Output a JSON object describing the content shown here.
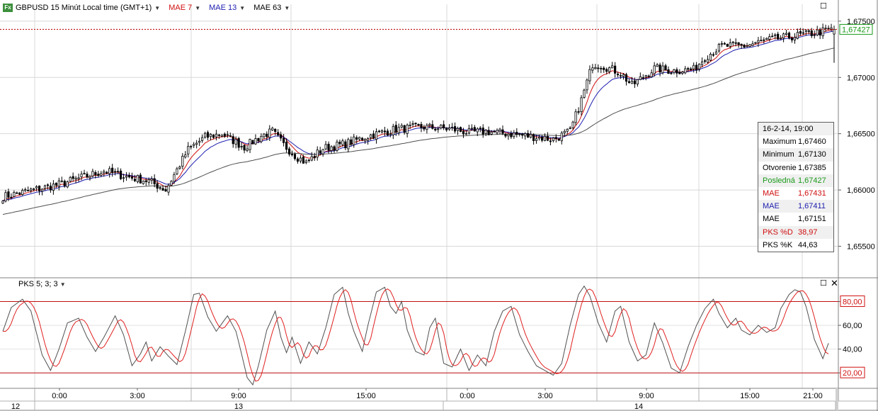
{
  "header": {
    "fx_label": "Fx",
    "title": "GBPUSD 15 Minút Local time (GMT+1)",
    "ma": [
      {
        "label": "MAE 7",
        "color": "#d01010"
      },
      {
        "label": "MAE 13",
        "color": "#2020b0"
      },
      {
        "label": "MAE 63",
        "color": "#000000"
      }
    ]
  },
  "info_box": {
    "date": "16-2-14, 19:00",
    "rows": [
      {
        "label": "Maximum",
        "value": "1,67460",
        "color": "#000000"
      },
      {
        "label": "Minimum",
        "value": "1,67130",
        "color": "#000000"
      },
      {
        "label": "Otvorenie",
        "value": "1,67385",
        "color": "#000000"
      },
      {
        "label": "Posledná",
        "value": "1,67427",
        "color": "#1a9a1a"
      },
      {
        "label": "MAE",
        "value": "1,67431",
        "color": "#d01010"
      },
      {
        "label": "MAE",
        "value": "1,67411",
        "color": "#2020b0"
      },
      {
        "label": "MAE",
        "value": "1,67151",
        "color": "#000000"
      },
      {
        "label": "PKS %D",
        "value": "38,97",
        "color": "#d01010"
      },
      {
        "label": "PKS %K",
        "value": "44,63",
        "color": "#000000"
      }
    ]
  },
  "indicator": {
    "label": "PKS 5; 3; 3"
  },
  "chart_data": [
    {
      "type": "candlestick",
      "title": "GBPUSD 15 Minút Local time (GMT+1)",
      "y_ticks": [
        "1,67500",
        "1,67000",
        "1,66500",
        "1,66000",
        "1,65500"
      ],
      "y_tick_values": [
        1.675,
        1.67,
        1.665,
        1.66,
        1.655
      ],
      "ylim": [
        1.6522,
        1.6765
      ],
      "last_price": "1,67427",
      "last_price_value": 1.67427,
      "grid": true,
      "price_anchors": [
        [
          0,
          1.6594
        ],
        [
          20,
          1.6605
        ],
        [
          36,
          1.6617
        ],
        [
          44,
          1.6612
        ],
        [
          52,
          1.6608
        ],
        [
          58,
          1.66
        ],
        [
          66,
          1.6636
        ],
        [
          72,
          1.6647
        ],
        [
          78,
          1.665
        ],
        [
          86,
          1.6638
        ],
        [
          92,
          1.6648
        ],
        [
          96,
          1.6652
        ],
        [
          100,
          1.664
        ],
        [
          104,
          1.6631
        ],
        [
          108,
          1.6624
        ],
        [
          114,
          1.6637
        ],
        [
          122,
          1.6641
        ],
        [
          130,
          1.6648
        ],
        [
          140,
          1.6654
        ],
        [
          150,
          1.6656
        ],
        [
          160,
          1.6654
        ],
        [
          166,
          1.6651
        ],
        [
          172,
          1.6652
        ],
        [
          180,
          1.665
        ],
        [
          190,
          1.6647
        ],
        [
          196,
          1.6645
        ],
        [
          202,
          1.6652
        ],
        [
          206,
          1.668
        ],
        [
          210,
          1.6712
        ],
        [
          214,
          1.671
        ],
        [
          220,
          1.6704
        ],
        [
          224,
          1.6693
        ],
        [
          232,
          1.6708
        ],
        [
          238,
          1.6706
        ],
        [
          246,
          1.6707
        ],
        [
          250,
          1.6718
        ],
        [
          256,
          1.6728
        ],
        [
          264,
          1.6728
        ],
        [
          272,
          1.6733
        ],
        [
          280,
          1.6736
        ],
        [
          290,
          1.674
        ],
        [
          296,
          1.6743
        ]
      ],
      "mae_periods": [
        7,
        13,
        63
      ]
    },
    {
      "type": "line",
      "title": "PKS 5; 3; 3",
      "series": [
        {
          "name": "PKS %K"
        },
        {
          "name": "PKS %D"
        }
      ],
      "levels": [
        "80,00",
        "20,00"
      ],
      "level_values": [
        80,
        20
      ],
      "y_ticks": [
        "80,00",
        "60,00",
        "40,00",
        "20,00"
      ],
      "y_tick_values": [
        80,
        60,
        40,
        20
      ],
      "ylim": [
        7,
        100
      ],
      "k_anchors": [
        [
          0,
          55
        ],
        [
          3,
          75
        ],
        [
          7,
          82
        ],
        [
          10,
          72
        ],
        [
          14,
          35
        ],
        [
          17,
          22
        ],
        [
          20,
          40
        ],
        [
          23,
          62
        ],
        [
          27,
          66
        ],
        [
          30,
          50
        ],
        [
          33,
          38
        ],
        [
          36,
          50
        ],
        [
          40,
          68
        ],
        [
          43,
          52
        ],
        [
          46,
          26
        ],
        [
          49,
          36
        ],
        [
          51,
          46
        ],
        [
          53,
          30
        ],
        [
          56,
          42
        ],
        [
          59,
          34
        ],
        [
          62,
          27
        ],
        [
          65,
          55
        ],
        [
          68,
          86
        ],
        [
          70,
          87
        ],
        [
          73,
          67
        ],
        [
          76,
          55
        ],
        [
          80,
          68
        ],
        [
          83,
          55
        ],
        [
          85,
          36
        ],
        [
          87,
          16
        ],
        [
          89,
          10
        ],
        [
          91,
          26
        ],
        [
          94,
          56
        ],
        [
          97,
          72
        ],
        [
          99,
          50
        ],
        [
          101,
          37
        ],
        [
          103,
          50
        ],
        [
          106,
          28
        ],
        [
          109,
          46
        ],
        [
          112,
          36
        ],
        [
          115,
          58
        ],
        [
          118,
          86
        ],
        [
          121,
          92
        ],
        [
          123,
          70
        ],
        [
          125,
          55
        ],
        [
          128,
          38
        ],
        [
          130,
          60
        ],
        [
          133,
          88
        ],
        [
          136,
          92
        ],
        [
          138,
          76
        ],
        [
          140,
          70
        ],
        [
          142,
          80
        ],
        [
          144,
          56
        ],
        [
          147,
          38
        ],
        [
          150,
          35
        ],
        [
          152,
          58
        ],
        [
          154,
          66
        ],
        [
          157,
          28
        ],
        [
          160,
          25
        ],
        [
          163,
          40
        ],
        [
          166,
          22
        ],
        [
          169,
          35
        ],
        [
          172,
          26
        ],
        [
          175,
          55
        ],
        [
          178,
          72
        ],
        [
          181,
          76
        ],
        [
          184,
          52
        ],
        [
          187,
          38
        ],
        [
          190,
          26
        ],
        [
          193,
          22
        ],
        [
          196,
          18
        ],
        [
          199,
          28
        ],
        [
          202,
          60
        ],
        [
          205,
          86
        ],
        [
          207,
          93
        ],
        [
          209,
          85
        ],
        [
          212,
          62
        ],
        [
          215,
          46
        ],
        [
          218,
          72
        ],
        [
          220,
          76
        ],
        [
          223,
          46
        ],
        [
          226,
          30
        ],
        [
          229,
          35
        ],
        [
          232,
          62
        ],
        [
          235,
          45
        ],
        [
          238,
          24
        ],
        [
          241,
          20
        ],
        [
          244,
          42
        ],
        [
          247,
          60
        ],
        [
          250,
          74
        ],
        [
          253,
          82
        ],
        [
          255,
          70
        ],
        [
          258,
          58
        ],
        [
          261,
          66
        ],
        [
          263,
          56
        ],
        [
          266,
          52
        ],
        [
          269,
          60
        ],
        [
          272,
          54
        ],
        [
          275,
          58
        ],
        [
          277,
          74
        ],
        [
          280,
          86
        ],
        [
          282,
          90
        ],
        [
          284,
          88
        ],
        [
          286,
          76
        ],
        [
          289,
          48
        ],
        [
          292,
          32
        ],
        [
          294,
          45
        ]
      ],
      "x_ticks": [
        "0:00",
        "3:00",
        "9:00",
        "15:00",
        "0:00",
        "3:00",
        "9:00",
        "15:00",
        "21:00"
      ],
      "date_labels": [
        "12",
        "13",
        "14"
      ]
    }
  ]
}
